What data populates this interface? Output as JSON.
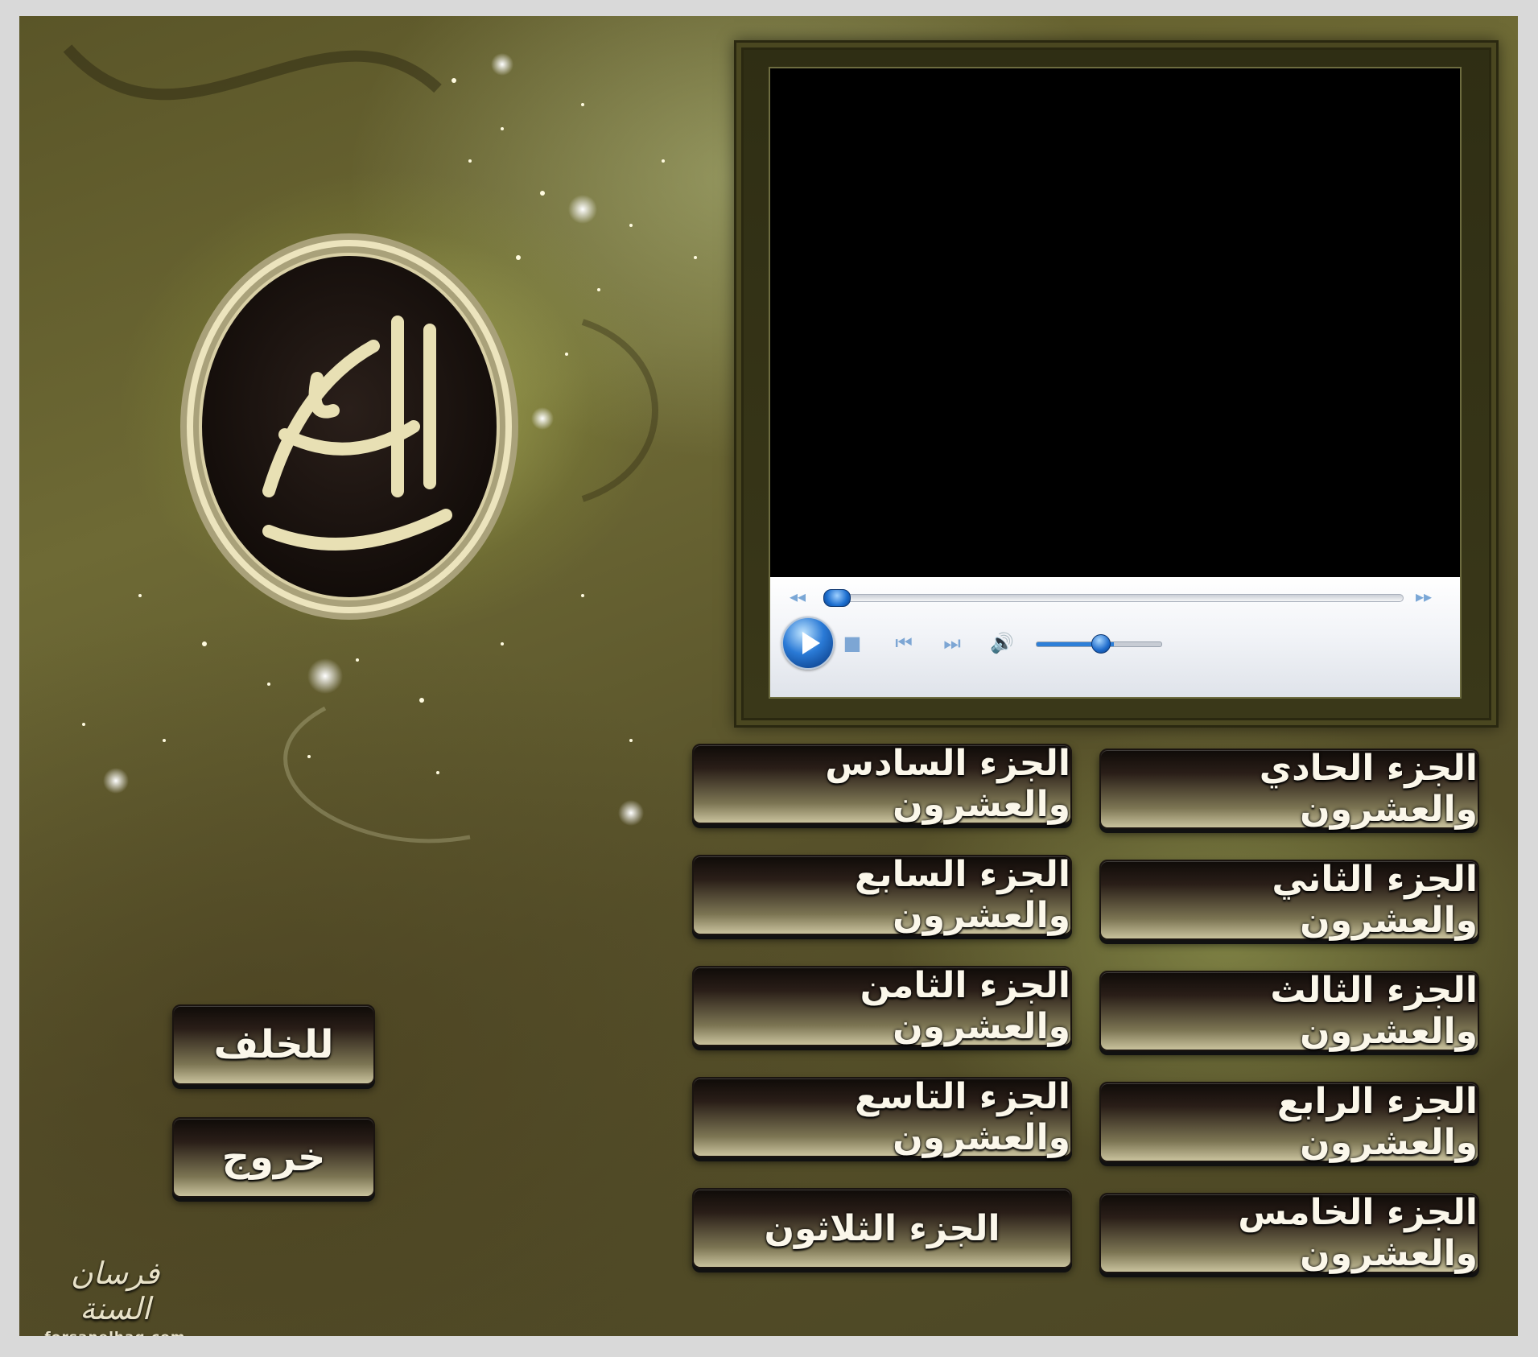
{
  "window": {
    "background_colors": [
      "#5a5528",
      "#6e6a35",
      "#4b4624"
    ],
    "accent_color": "#c9c29d"
  },
  "seal": {
    "icon": "quran-calligraphy-seal-icon",
    "text": "القرآن الكريم"
  },
  "player": {
    "icons": {
      "rewind": "seek-back-icon",
      "forward": "seek-forward-icon",
      "play": "play-icon",
      "stop": "stop-icon",
      "previous": "previous-track-icon",
      "next": "next-track-icon",
      "volume": "volume-icon"
    },
    "progress": 0.0,
    "volume": 0.62,
    "player_colors": {
      "controls_bg": "#eef0f4",
      "accent": "#1d6fd0"
    }
  },
  "juz_buttons": {
    "right_column": [
      {
        "label": "الجزء الحادي والعشرون"
      },
      {
        "label": "الجزء الثاني والعشرون"
      },
      {
        "label": "الجزء الثالث والعشرون"
      },
      {
        "label": "الجزء الرابع والعشرون"
      },
      {
        "label": "الجزء الخامس والعشرون"
      }
    ],
    "left_column": [
      {
        "label": "الجزء السادس والعشرون"
      },
      {
        "label": "الجزء السابع والعشرون"
      },
      {
        "label": "الجزء الثامن والعشرون"
      },
      {
        "label": "الجزء التاسع والعشرون"
      },
      {
        "label": "الجزء الثلاثون"
      }
    ]
  },
  "nav": {
    "back_label": "للخلف",
    "exit_label": "خروج"
  },
  "logo": {
    "script": "فرسان السنة",
    "site": "forsanelhaq.com"
  }
}
